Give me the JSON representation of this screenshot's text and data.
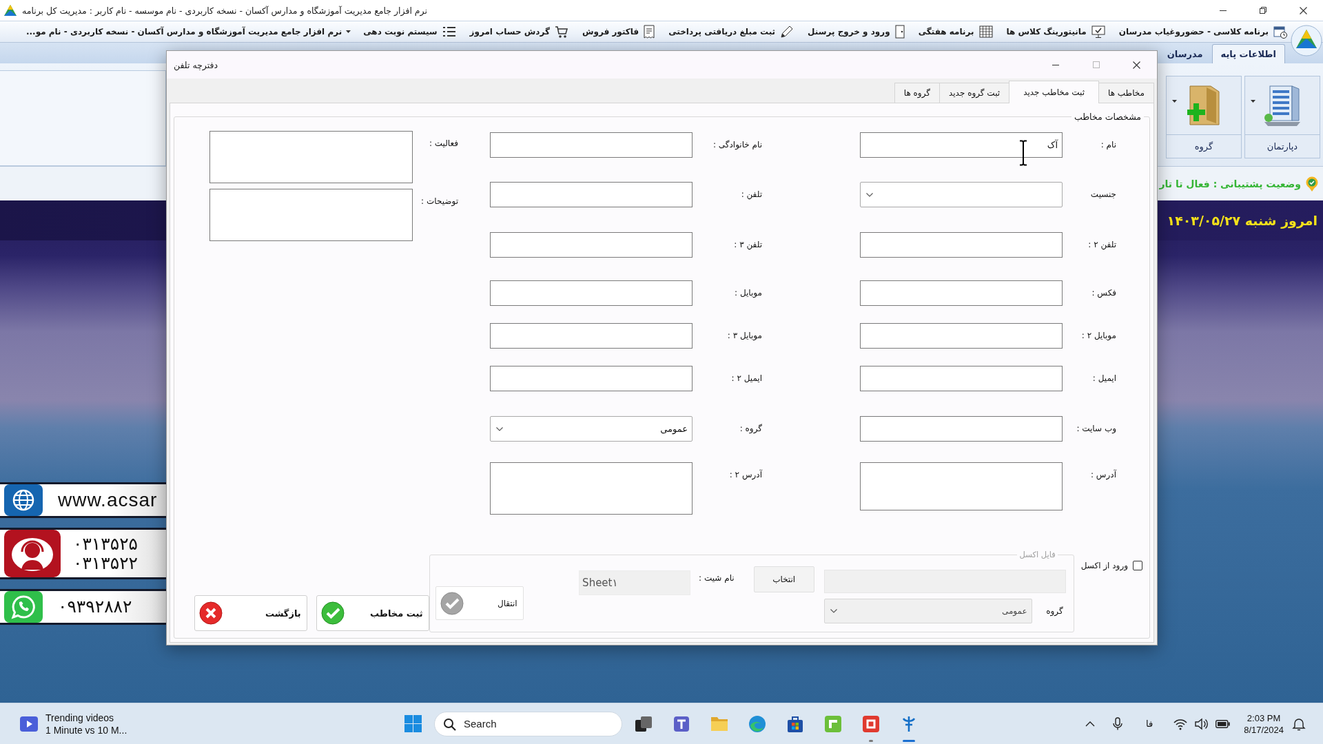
{
  "window": {
    "title": "نرم افزار جامع مدیریت آموزشگاه و مدارس آکسان - نسخه کاربردی - نام موسسه - نام کاربر : مدیریت کل برنامه"
  },
  "toolbar": {
    "items": [
      {
        "label": "برنامه کلاسی - حضوروغیاب مدرسان"
      },
      {
        "label": "مانیتورینگ کلاس ها"
      },
      {
        "label": "برنامه هفتگی"
      },
      {
        "label": "ورود و خروج پرسنل"
      },
      {
        "label": "ثبت مبلغ دریافتی پرداختی"
      },
      {
        "label": "فاکتور فروش"
      },
      {
        "label": "گردش حساب امروز"
      },
      {
        "label": "سیستم نوبت دهی"
      }
    ],
    "selector": {
      "value": "نرم افزار جامع مدیریت آموزشگاه و مدارس آکسان - نسخه کاربردی - نام مو..."
    }
  },
  "ribbon": {
    "tabs": [
      {
        "label": "اطلاعات پایه",
        "selected": true
      },
      {
        "label": "مدرسان",
        "selected": false
      }
    ],
    "buttons": [
      {
        "label": "دپارتمان"
      },
      {
        "label": "گروه"
      }
    ]
  },
  "status": {
    "support": "وضعیت پشتیبانی : فعال تا تار"
  },
  "date_banner": {
    "text": "امروز شنبه ۱۴۰۳/۰۵/۲۷"
  },
  "contact_banners": [
    {
      "kind": "web",
      "lines": [
        "www.acsar"
      ]
    },
    {
      "kind": "phone",
      "lines": [
        "۰۳۱۳۵۲۵",
        "۰۳۱۳۵۲۲"
      ]
    },
    {
      "kind": "messenger",
      "lines": [
        "۰۹۳۹۲۸۸۲"
      ]
    }
  ],
  "dialog": {
    "title": "دفترچه تلفن",
    "tabs": [
      {
        "label": "مخاطب ها",
        "selected": false
      },
      {
        "label": "ثبت مخاطب جدید",
        "selected": true
      },
      {
        "label": "ثبت گروه جدید",
        "selected": false
      },
      {
        "label": "گروه ها",
        "selected": false
      }
    ],
    "form": {
      "title": "مشخصات مخاطب",
      "columns": [
        {
          "fields": [
            {
              "label": "نام :",
              "kind": "text",
              "value": "آک"
            },
            {
              "label": "جنسیت",
              "kind": "combo"
            },
            {
              "label": "تلفن ۲ :",
              "kind": "text"
            },
            {
              "label": "فکس :",
              "kind": "text"
            },
            {
              "label": "موبایل ۲ :",
              "kind": "text"
            },
            {
              "label": "ایمیل :",
              "kind": "text"
            },
            {
              "label": "وب سایت :",
              "kind": "text"
            },
            {
              "label": "آدرس :",
              "kind": "textarea"
            }
          ]
        },
        {
          "fields": [
            {
              "label": "نام خانوادگی :",
              "kind": "text"
            },
            {
              "label": "تلفن :",
              "kind": "text"
            },
            {
              "label": "تلفن ۳ :",
              "kind": "text"
            },
            {
              "label": "موبایل :",
              "kind": "text"
            },
            {
              "label": "موبایل ۳ :",
              "kind": "text"
            },
            {
              "label": "ایمیل ۲ :",
              "kind": "text"
            },
            {
              "label": "گروه :",
              "kind": "combo",
              "value": "عمومی"
            },
            {
              "label": "آدرس ۲ :",
              "kind": "textarea"
            }
          ]
        },
        {
          "fields": [
            {
              "label": "فعالیت :",
              "kind": "textarea"
            },
            {
              "label": "توضیحات :",
              "kind": "textarea"
            }
          ]
        }
      ]
    },
    "excel": {
      "checkbox": {
        "label": "ورود از اکسل",
        "checked": false
      },
      "title": "فایل اکسل",
      "disabled": true,
      "browse": "انتخاب",
      "sheet_label": "نام شیت :",
      "sheet_value": "Sheet۱",
      "group_label": "گروه",
      "group_value": "عمومی",
      "transfer": "انتقال"
    },
    "actions": [
      {
        "label": "ثبت مخاطب",
        "kind": "save"
      },
      {
        "label": "بازگشت",
        "kind": "back"
      }
    ]
  },
  "taskbar": {
    "widget": {
      "title": "Trending videos",
      "subtitle": "1 Minute vs 10 M..."
    },
    "search": {
      "placeholder": "Search"
    },
    "apps": [
      {
        "running": false,
        "selected": false
      },
      {
        "running": false,
        "selected": false
      },
      {
        "running": false,
        "selected": false
      },
      {
        "running": false,
        "selected": false
      },
      {
        "running": false,
        "selected": false
      },
      {
        "running": false,
        "selected": false
      },
      {
        "running": true,
        "selected": false
      },
      {
        "running": true,
        "selected": true
      }
    ],
    "tray": {
      "language": "فا",
      "time": "2:03 PM",
      "date": "8/17/2024"
    }
  }
}
